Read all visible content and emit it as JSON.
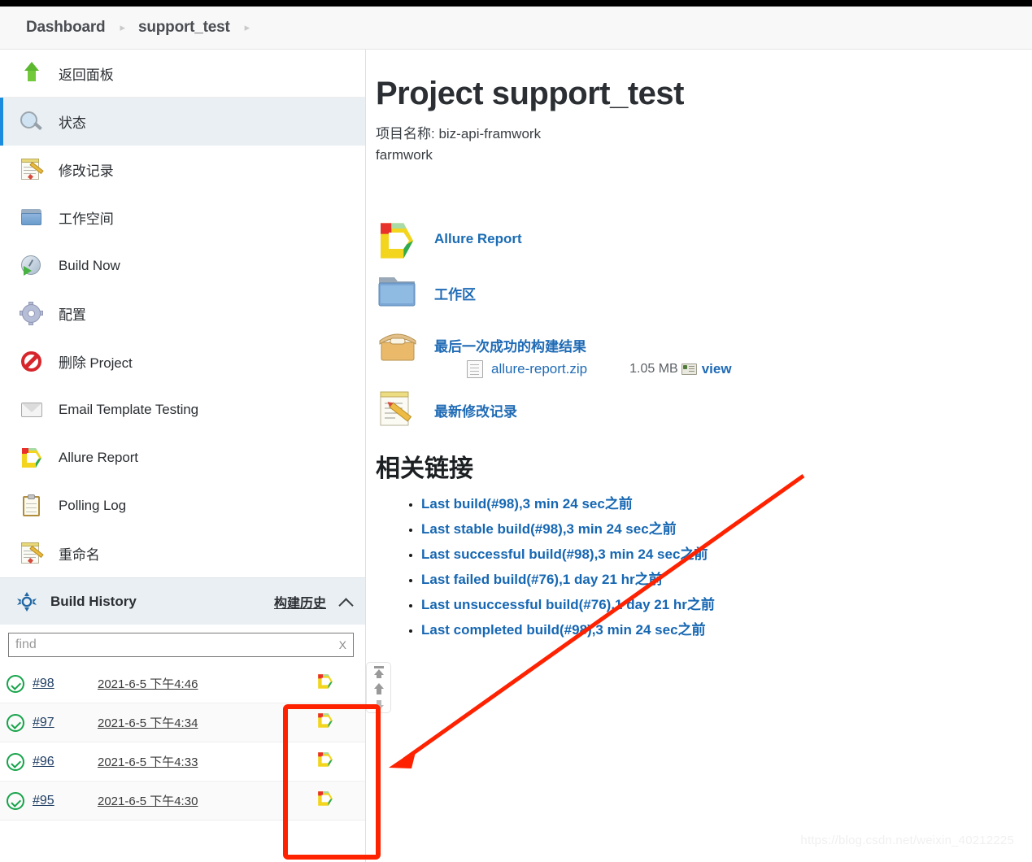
{
  "breadcrumb": {
    "items": [
      "Dashboard",
      "support_test"
    ],
    "separator": "▸"
  },
  "sidebar": {
    "tasks": [
      {
        "label": "返回面板",
        "icon": "up-arrow-icon",
        "active": false
      },
      {
        "label": "状态",
        "icon": "magnifier-icon",
        "active": true
      },
      {
        "label": "修改记录",
        "icon": "notepad-pencil-icon",
        "active": false
      },
      {
        "label": "工作空间",
        "icon": "folder-icon",
        "active": false
      },
      {
        "label": "Build Now",
        "icon": "build-clock-icon",
        "active": false
      },
      {
        "label": "配置",
        "icon": "gear-icon",
        "active": false
      },
      {
        "label": "删除 Project",
        "icon": "delete-ban-icon",
        "active": false
      },
      {
        "label": "Email Template Testing",
        "icon": "mail-icon",
        "active": false
      },
      {
        "label": "Allure Report",
        "icon": "allure-icon",
        "active": false
      },
      {
        "label": "Polling Log",
        "icon": "clipboard-icon",
        "active": false
      },
      {
        "label": "重命名",
        "icon": "notepad-pencil-icon",
        "active": false
      }
    ]
  },
  "build_history": {
    "title": "Build History",
    "link_label": "构建历史",
    "search_placeholder": "find",
    "search_value": "",
    "clear_label": "X",
    "rows": [
      {
        "status": "success",
        "number": "#98",
        "date": "2021-6-5 下午4:46"
      },
      {
        "status": "success",
        "number": "#97",
        "date": "2021-6-5 下午4:34"
      },
      {
        "status": "success",
        "number": "#96",
        "date": "2021-6-5 下午4:33"
      },
      {
        "status": "success",
        "number": "#95",
        "date": "2021-6-5 下午4:30"
      }
    ]
  },
  "main": {
    "title": "Project support_test",
    "description_line1": "项目名称: biz-api-framwork",
    "description_line2": "farmwork",
    "links": [
      {
        "label": "Allure Report",
        "icon": "allure-icon"
      },
      {
        "label": "工作区",
        "icon": "folder-icon"
      },
      {
        "label": "最后一次成功的构建结果",
        "icon": "package-box-icon"
      },
      {
        "label": "最新修改记录",
        "icon": "notepad-pencil-icon"
      }
    ],
    "artifact": {
      "name": "allure-report.zip",
      "size": "1.05 MB",
      "view_label": "view"
    },
    "related_title": "相关链接",
    "related_links": [
      "Last build(#98),3 min 24 sec之前",
      "Last stable build(#98),3 min 24 sec之前",
      "Last successful build(#98),3 min 24 sec之前",
      "Last failed build(#76),1 day 21 hr之前",
      "Last unsuccessful build(#76),1 day 21 hr之前",
      "Last completed build(#98),3 min 24 sec之前"
    ]
  },
  "watermark": "https://blog.csdn.net/weixin_40212225",
  "colors": {
    "accent_blue": "#1f6bb5",
    "active_bg": "#eaeff3",
    "active_border": "#1b8bdd",
    "success_green": "#16a34a",
    "annotation_red": "#ff2200"
  }
}
